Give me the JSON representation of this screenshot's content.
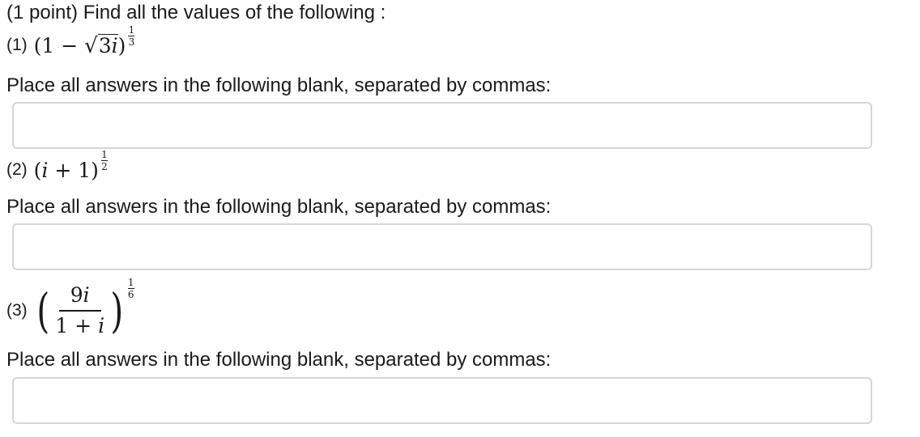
{
  "intro": "(1 point) Find all the values of the following :",
  "instruction": "Place all answers in the following blank, separated by commas:",
  "problems": [
    {
      "label": "(1)",
      "expr_open": "(1 − ",
      "sqrt_radical": "√",
      "sqrt_body": "3",
      "expr_var": "i",
      "expr_close": ")",
      "exp_num": "1",
      "exp_den": "3",
      "answer": ""
    },
    {
      "label": "(2)",
      "expr_open": "(",
      "expr_var": "i",
      "expr_mid": " + 1)",
      "exp_num": "1",
      "exp_den": "2",
      "answer": ""
    },
    {
      "label": "(3)",
      "paren_open": "(",
      "num_coef": "9",
      "num_var": "i",
      "den_const": "1 + ",
      "den_var": "i",
      "paren_close": ")",
      "exp_num": "1",
      "exp_den": "6",
      "answer": ""
    }
  ]
}
